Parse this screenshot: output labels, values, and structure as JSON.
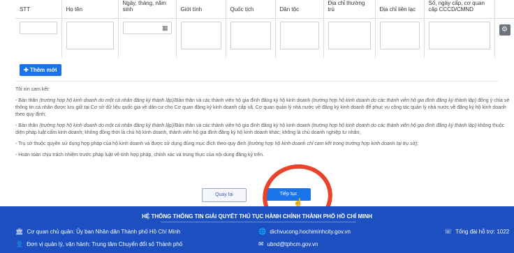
{
  "table": {
    "headers": [
      "STT",
      "Họ tên",
      "Ngày, tháng, năm sinh",
      "Giới tính",
      "Quốc tịch",
      "Dân tộc",
      "Địa chỉ thường trú",
      "Địa chỉ liên lạc",
      "Số, ngày cấp, cơ quan cấp CCCD/CMND"
    ],
    "row_action_icon": "gear-icon",
    "date_icon": "calendar-icon"
  },
  "add_button": {
    "icon": "plus-icon",
    "label": "Thêm mới"
  },
  "commitment": {
    "heading": "Tôi xin cam kết:",
    "p1_a": "- Bản thân ",
    "p1_b": "(trường hợp hộ kinh doanh do một cá nhân đăng ký thành lập)",
    "p1_c": "/Bản thân và các thành viên hộ gia đình đăng ký hộ kinh doanh ",
    "p1_d": "(trường hợp hộ kinh doanh do các thành viên hộ gia đình đăng ký thành lập)",
    "p1_e": " đồng ý chia sẻ thông tin cá nhân được lưu giữ tại Cơ sở dữ liệu quốc gia về dân cư cho Cơ quan đăng ký kinh doanh cấp xã, Cơ quan quản lý nhà nước về đăng ký kinh doanh để phục vụ công tác quản lý nhà nước về đăng ký hộ kinh doanh theo quy định;",
    "p2_a": "- Bản thân ",
    "p2_b": "(trường hợp hộ kinh doanh do một cá nhân đăng ký thành lập)",
    "p2_c": "/Bản thân và các thành viên hộ gia đình đăng ký hộ kinh doanh ",
    "p2_d": "(trường hợp hộ kinh doanh do các thành viên hộ gia đình đăng ký thành lập)",
    "p2_e": " không thuộc diện pháp luật cấm kinh doanh; không đồng thời là chủ hộ kinh doanh, thành viên hộ gia đình đăng ký hộ kinh doanh khác; không là chủ doanh nghiệp tư nhân;",
    "p3_a": "- Trụ sở thuộc quyền sử dụng hợp pháp của hộ kinh doanh và được sử dụng đúng mục đích theo quy định ",
    "p3_b": "(trường hợp hộ kinh doanh chỉ cam kết trong trường hợp kinh doanh tại trụ sở)",
    "p3_c": ";",
    "p4": "- Hoàn toàn chịu trách nhiệm trước pháp luật về tính hợp pháp, chính xác và trung thực của nội dung đăng ký trên."
  },
  "actions": {
    "back": "Quay lại",
    "next": "Tiếp tục"
  },
  "footer": {
    "title": "HỆ THỐNG THÔNG TIN GIẢI QUYẾT THỦ TỤC HÀNH CHÍNH THÀNH PHỐ HỒ CHÍ MINH",
    "governing_agency": "Cơ quan chủ quản: Ủy ban Nhân dân Thành phố Hồ Chí Minh",
    "operator": "Đơn vị quản lý, vận hành: Trung tâm Chuyển đổi số Thành phố",
    "website": "dichvucong.hochiminhcity.gov.vn",
    "email": "ubnd@tphcm.gov.vn",
    "hotline": "Tổng đài hỗ trợ: 1022"
  },
  "colors": {
    "primary": "#1a73e8",
    "footer_bg": "#1c4fbf",
    "annotation": "#e8432b"
  }
}
